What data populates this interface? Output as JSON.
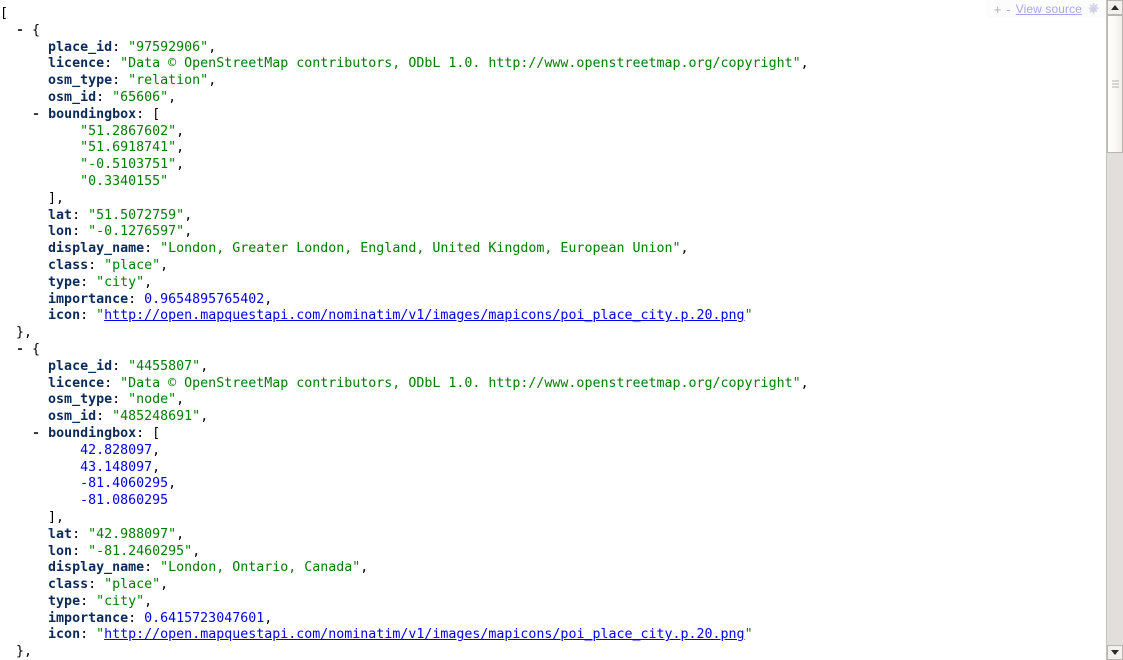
{
  "toolbar": {
    "expand_label": "+",
    "collapse_label": "-",
    "view_source_label": "View source",
    "gear_icon_name": "gear-icon"
  },
  "scrollbar": {
    "up_arrow_name": "scroll-up-arrow",
    "down_arrow_name": "scroll-down-arrow",
    "thumb_name": "scroll-thumb"
  },
  "colors": {
    "key": "#0b2a5a",
    "string": "#007d00",
    "number": "#0000e6",
    "link": "#0000ee",
    "background": "#ffffff",
    "scrollbar_track": "#e1dedb",
    "toolbar_link": "#3b3bbb"
  },
  "tokens": {
    "colon": ":",
    "comma": ",",
    "open_array": "[",
    "close_array": "]",
    "open_object": "{",
    "close_object": "}",
    "quote": "\"",
    "toggle_collapse": "-"
  },
  "json_document": {
    "root_open": "[",
    "records": [
      {
        "place_id": "97592906",
        "licence": "Data © OpenStreetMap contributors, ODbL 1.0. http://www.openstreetmap.org/copyright",
        "osm_type": "relation",
        "osm_id": "65606",
        "boundingbox": [
          "51.2867602",
          "51.6918741",
          "-0.5103751",
          "0.3340155"
        ],
        "boundingbox_is_string": true,
        "lat": "51.5072759",
        "lon": "-0.1276597",
        "display_name": "London, Greater London, England, United Kingdom, European Union",
        "class": "place",
        "type": "city",
        "importance": "0.9654895765402",
        "icon": "http://open.mapquestapi.com/nominatim/v1/images/mapicons/poi_place_city.p.20.png"
      },
      {
        "place_id": "4455807",
        "licence": "Data © OpenStreetMap contributors, ODbL 1.0. http://www.openstreetmap.org/copyright",
        "osm_type": "node",
        "osm_id": "485248691",
        "boundingbox": [
          "42.828097",
          "43.148097",
          "-81.4060295",
          "-81.0860295"
        ],
        "boundingbox_is_string": false,
        "lat": "42.988097",
        "lon": "-81.2460295",
        "display_name": "London, Ontario, Canada",
        "class": "place",
        "type": "city",
        "importance": "0.6415723047601",
        "icon": "http://open.mapquestapi.com/nominatim/v1/images/mapicons/poi_place_city.p.20.png"
      }
    ],
    "labels": {
      "place_id": "place_id",
      "licence": "licence",
      "osm_type": "osm_type",
      "osm_id": "osm_id",
      "boundingbox": "boundingbox",
      "lat": "lat",
      "lon": "lon",
      "display_name": "display_name",
      "class": "class",
      "type": "type",
      "importance": "importance",
      "icon": "icon"
    }
  }
}
